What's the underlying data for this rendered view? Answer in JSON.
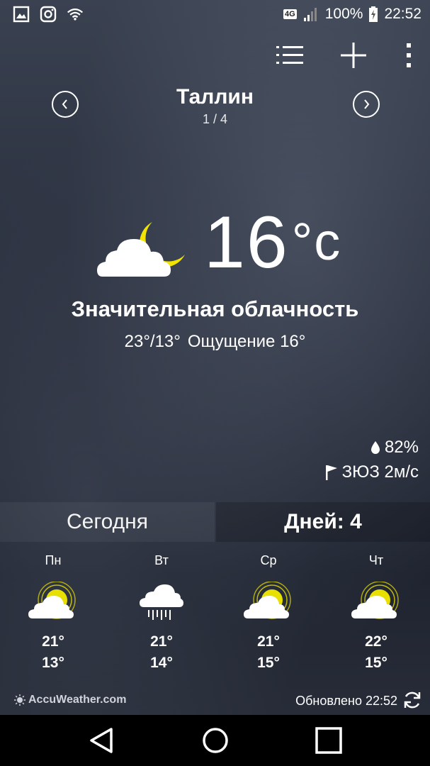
{
  "status_bar": {
    "network": "4G",
    "battery": "100%",
    "time": "22:52",
    "left_icons": [
      "gallery-icon",
      "instagram-icon",
      "wifi-icon"
    ]
  },
  "toolbar": {
    "icons": [
      "list-icon",
      "add-icon",
      "more-vert-icon"
    ]
  },
  "location": {
    "city": "Таллин",
    "index": "1 / 4"
  },
  "current": {
    "temp": "16",
    "unit": "°c",
    "condition": "Значительная облачность",
    "hilo": "23°/13°",
    "feels_like": "Ощущение 16°",
    "humidity": "82%",
    "wind": "ЗЮЗ 2м/с",
    "icon": "cloud-moon-icon"
  },
  "tabs": {
    "today": "Сегодня",
    "days": "Дней: 4"
  },
  "forecast": [
    {
      "day": "Пн",
      "hi": "21°",
      "lo": "13°",
      "icon": "sun-cloud-icon"
    },
    {
      "day": "Вт",
      "hi": "21°",
      "lo": "14°",
      "icon": "rain-cloud-icon"
    },
    {
      "day": "Ср",
      "hi": "21°",
      "lo": "15°",
      "icon": "sun-cloud-icon"
    },
    {
      "day": "Чт",
      "hi": "22°",
      "lo": "15°",
      "icon": "sun-cloud-icon"
    }
  ],
  "footer": {
    "brand": "AccuWeather.com",
    "updated": "Обновлено 22:52"
  },
  "colors": {
    "sun": "#e8e000",
    "moon": "#f2e400",
    "background": "#2c3240"
  }
}
